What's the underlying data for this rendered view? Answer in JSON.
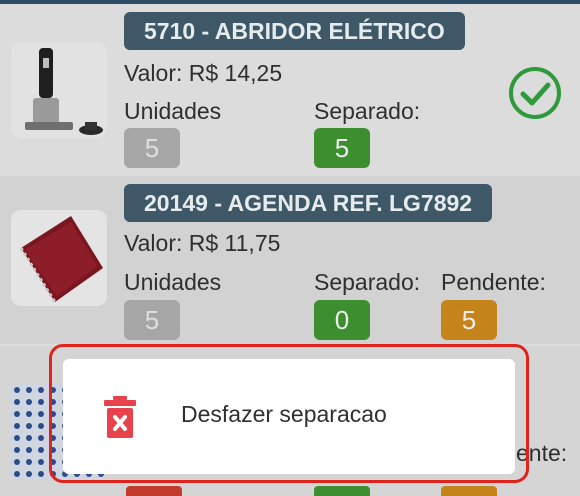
{
  "items": [
    {
      "title": "5710 - ABRIDOR ELÉTRICO",
      "valor": "Valor: R$ 14,25",
      "unidades_label": "Unidades",
      "unidades_value": "5",
      "separado_label": "Separado:",
      "separado_value": "5",
      "icon": "check-circle-icon"
    },
    {
      "title": "20149 - AGENDA REF. LG7892",
      "valor": "Valor: R$ 11,75",
      "unidades_label": "Unidades",
      "unidades_value": "5",
      "separado_label": "Separado:",
      "separado_value": "0",
      "pendente_label": "Pendente:",
      "pendente_value": "5"
    },
    {
      "pendente_label_partial": "ente:"
    }
  ],
  "dialog": {
    "option_label": "Desfazer separacao",
    "option_icon": "trash-icon"
  },
  "colors": {
    "title_pill": "#3f5867",
    "green": "#3c8e2e",
    "orange": "#c4841b",
    "gray": "#a6a6a6",
    "highlight_border": "#e0241c",
    "trash": "#e8424c",
    "check": "#2e9a3c"
  }
}
